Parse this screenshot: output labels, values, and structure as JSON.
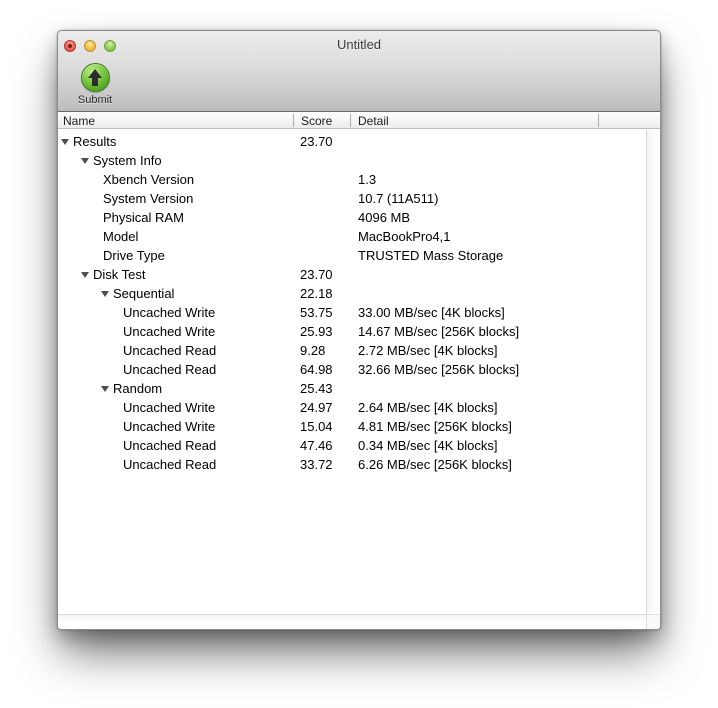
{
  "window": {
    "title": "Untitled"
  },
  "titlebar_buttons": {
    "close": "close",
    "minimize": "minimize",
    "zoom": "zoom",
    "close_modified_indicator": true
  },
  "toolbar": {
    "submit_label": "Submit"
  },
  "table": {
    "columns": [
      "Name",
      "Score",
      "Detail"
    ],
    "rows": [
      {
        "level": 0,
        "expandable": true,
        "name": "Results",
        "score": "23.70",
        "detail": ""
      },
      {
        "level": 1,
        "expandable": true,
        "name": "System Info",
        "score": "",
        "detail": ""
      },
      {
        "level": 2,
        "expandable": false,
        "name": "Xbench Version",
        "score": "",
        "detail": "1.3"
      },
      {
        "level": 2,
        "expandable": false,
        "name": "System Version",
        "score": "",
        "detail": "10.7 (11A511)"
      },
      {
        "level": 2,
        "expandable": false,
        "name": "Physical RAM",
        "score": "",
        "detail": "4096 MB"
      },
      {
        "level": 2,
        "expandable": false,
        "name": "Model",
        "score": "",
        "detail": "MacBookPro4,1"
      },
      {
        "level": 2,
        "expandable": false,
        "name": "Drive Type",
        "score": "",
        "detail": "TRUSTED Mass Storage"
      },
      {
        "level": 1,
        "expandable": true,
        "name": "Disk Test",
        "score": "23.70",
        "detail": ""
      },
      {
        "level": 2,
        "expandable": true,
        "name": "Sequential",
        "score": "22.18",
        "detail": ""
      },
      {
        "level": 3,
        "expandable": false,
        "name": "Uncached Write",
        "score": "53.75",
        "detail": "33.00 MB/sec [4K blocks]"
      },
      {
        "level": 3,
        "expandable": false,
        "name": "Uncached Write",
        "score": "25.93",
        "detail": "14.67 MB/sec [256K blocks]"
      },
      {
        "level": 3,
        "expandable": false,
        "name": "Uncached Read",
        "score": "9.28",
        "detail": "2.72 MB/sec [4K blocks]"
      },
      {
        "level": 3,
        "expandable": false,
        "name": "Uncached Read",
        "score": "64.98",
        "detail": "32.66 MB/sec [256K blocks]"
      },
      {
        "level": 2,
        "expandable": true,
        "name": "Random",
        "score": "25.43",
        "detail": ""
      },
      {
        "level": 3,
        "expandable": false,
        "name": "Uncached Write",
        "score": "24.97",
        "detail": "2.64 MB/sec [4K blocks]"
      },
      {
        "level": 3,
        "expandable": false,
        "name": "Uncached Write",
        "score": "15.04",
        "detail": "4.81 MB/sec [256K blocks]"
      },
      {
        "level": 3,
        "expandable": false,
        "name": "Uncached Read",
        "score": "47.46",
        "detail": "0.34 MB/sec [4K blocks]"
      },
      {
        "level": 3,
        "expandable": false,
        "name": "Uncached Read",
        "score": "33.72",
        "detail": "6.26 MB/sec [256K blocks]"
      }
    ]
  },
  "colors": {
    "submit_green": "#52a622",
    "traffic_red": "#ee6d60",
    "traffic_yellow": "#f5c64a",
    "traffic_green": "#9ad45e",
    "chrome_gradient_top": "#ececec",
    "chrome_gradient_bottom": "#bcbcbc",
    "disclosure_triangle": "#4e4e4e"
  }
}
